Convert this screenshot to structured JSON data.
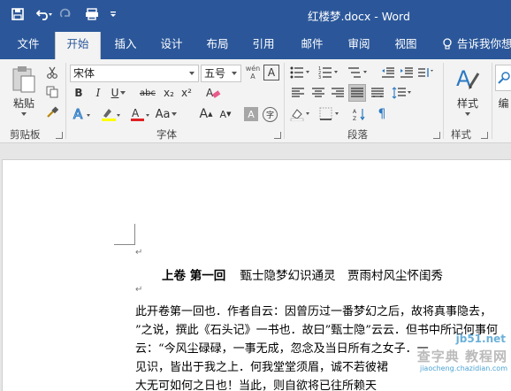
{
  "window": {
    "title": "红楼梦.docx - Word"
  },
  "qat": {
    "save": "save-icon",
    "undo": "undo-icon",
    "redo": "redo-icon",
    "touch": "touch-mode-icon",
    "customize": "customize-qat-icon"
  },
  "tabs": [
    {
      "label": "文件"
    },
    {
      "label": "开始"
    },
    {
      "label": "插入"
    },
    {
      "label": "设计"
    },
    {
      "label": "布局"
    },
    {
      "label": "引用"
    },
    {
      "label": "邮件"
    },
    {
      "label": "审阅"
    },
    {
      "label": "视图"
    }
  ],
  "tellme": {
    "label": "告诉我你想"
  },
  "ribbon": {
    "clipboard": {
      "label": "剪贴板",
      "paste_label": "粘贴"
    },
    "font": {
      "label": "字体",
      "font_name": "宋体",
      "font_size": "五号",
      "phonetic": "wén\nA",
      "bold": "B",
      "italic": "I",
      "underline": "U",
      "strike": "abc",
      "sub": "x₂",
      "sup": "x²",
      "grow": "A",
      "shrink": "A",
      "shade": "A",
      "enclose": "字"
    },
    "paragraph": {
      "label": "段落"
    },
    "styles": {
      "label": "样式",
      "button_label": "样式"
    },
    "editing": {
      "button_label": "编"
    }
  },
  "document": {
    "heading_part1": "上卷 第一回",
    "heading_part2": "甄士隐梦幻识通灵　贾雨村风尘怀闺秀",
    "para_mark": "↵",
    "lines": [
      "此开卷第一回也．作者自云：因曾历过一番梦幻之后，故将真事隐去，",
      "”之说，撰此《石头记》一书也．故曰”甄士隐”云云．但书中所记何事何",
      "云：“今风尘碌碌，一事无成，忽念及当日所有之女子．一",
      "见识，皆出于我之上．何我堂堂须眉，诚不若彼裙",
      "大无可如何之日也！当此，则自欲将已往所赖天"
    ]
  },
  "watermark": {
    "site": "jb51.net",
    "text": "查字典 教程网",
    "sub": "jiaocheng.chazidian.com"
  }
}
